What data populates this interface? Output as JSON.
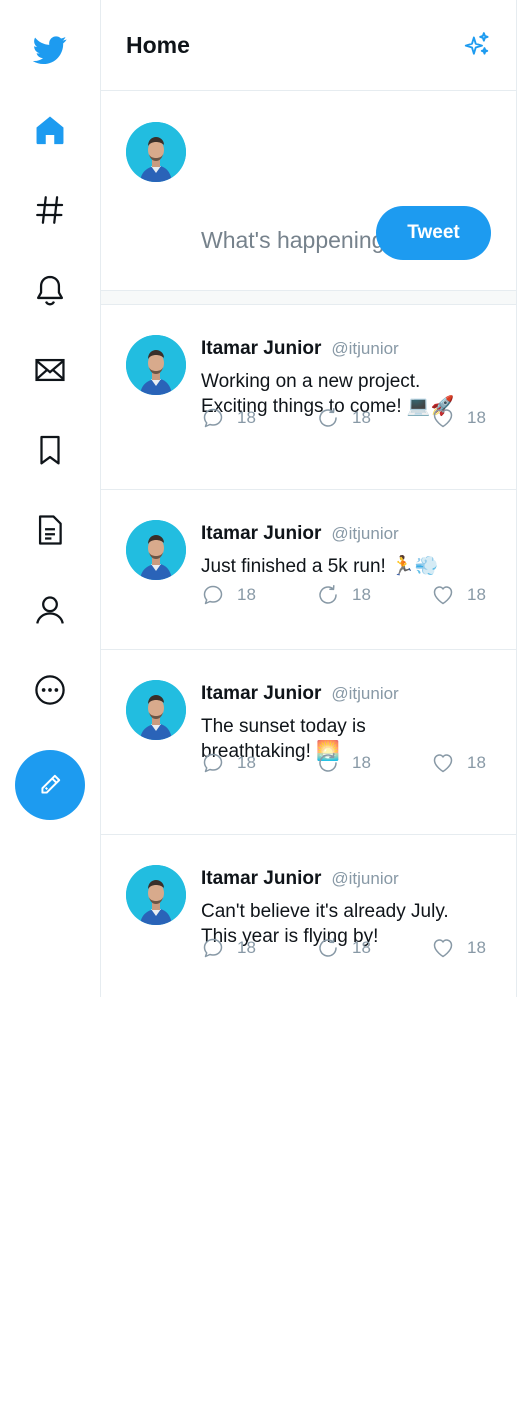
{
  "header": {
    "title": "Home"
  },
  "composer": {
    "placeholder": "What's happening?",
    "tweet_label": "Tweet"
  },
  "sidebar": {
    "items": [
      {
        "icon": "twitter-logo-icon"
      },
      {
        "icon": "home-icon"
      },
      {
        "icon": "explore-hashtag-icon"
      },
      {
        "icon": "bell-icon"
      },
      {
        "icon": "mail-icon"
      },
      {
        "icon": "bookmark-icon"
      },
      {
        "icon": "lists-icon"
      },
      {
        "icon": "profile-icon"
      },
      {
        "icon": "more-icon"
      }
    ],
    "compose_icon": "feather-icon"
  },
  "colors": {
    "accent": "#1d9bf0",
    "muted": "#8899a6",
    "border": "#e6ecf0"
  },
  "tweets": [
    {
      "name": "Itamar Junior",
      "handle": "@itjunior",
      "text_lines": [
        "Working on a new project.",
        "Exciting things to come! 💻🚀"
      ],
      "replies": "18",
      "retweets": "18",
      "likes": "18"
    },
    {
      "name": "Itamar Junior",
      "handle": "@itjunior",
      "text_lines": [
        "Just finished a 5k run! 🏃💨"
      ],
      "replies": "18",
      "retweets": "18",
      "likes": "18"
    },
    {
      "name": "Itamar Junior",
      "handle": "@itjunior",
      "text_lines": [
        "The sunset today is",
        "breathtaking! 🌅"
      ],
      "replies": "18",
      "retweets": "18",
      "likes": "18"
    },
    {
      "name": "Itamar Junior",
      "handle": "@itjunior",
      "text_lines": [
        "Can't believe it's already July.",
        "This year is flying by!"
      ],
      "replies": "18",
      "retweets": "18",
      "likes": "18"
    }
  ]
}
